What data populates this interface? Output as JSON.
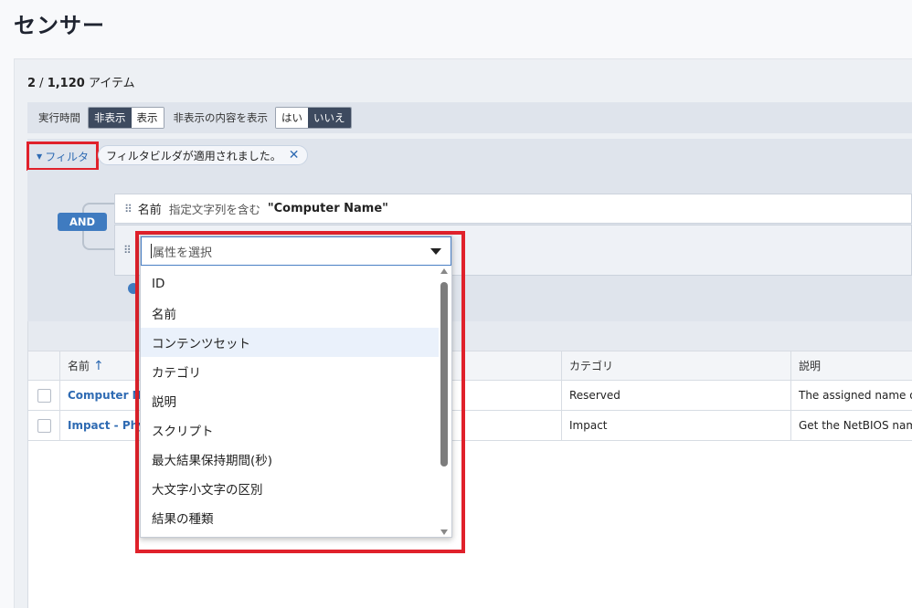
{
  "page": {
    "title": "センサー"
  },
  "summary": {
    "shown": "2",
    "total": "1,120",
    "unit": "アイテム",
    "sep": " / "
  },
  "toolbar": {
    "exec_time_label": "実行時間",
    "exec_time_hide": "非表示",
    "exec_time_show": "表示",
    "show_hidden_label": "非表示の内容を表示",
    "show_hidden_yes": "はい",
    "show_hidden_no": "いいえ"
  },
  "filter": {
    "toggle_label": "フィルタ",
    "chip_text": "フィルタビルダが適用されました。",
    "chip_close": "✕"
  },
  "builder": {
    "operator": "AND",
    "rule1": {
      "field": "名前",
      "op": "指定文字列を含む",
      "value": "\"Computer Name\""
    }
  },
  "dropdown": {
    "placeholder": "属性を選択",
    "items": [
      "ID",
      "名前",
      "コンテンツセット",
      "カテゴリ",
      "説明",
      "スクリプト",
      "最大結果保持期間(秒)",
      "大文字小文字の区別",
      "結果の種類"
    ],
    "highlighted_index": 2
  },
  "table": {
    "columns": {
      "name": "名前",
      "category": "カテゴリ",
      "description": "説明"
    },
    "sort_icon": "↑",
    "rows": [
      {
        "name": "Computer Na",
        "category": "Reserved",
        "description": "The assigned name of"
      },
      {
        "name": "Impact - Phy",
        "category": "Impact",
        "description": "Get the NetBIOS name"
      }
    ]
  }
}
